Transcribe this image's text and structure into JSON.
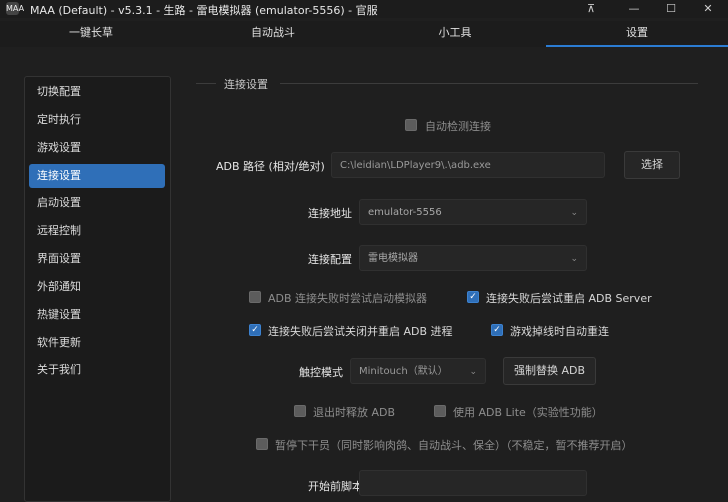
{
  "titlebar": {
    "app_icon": "MAA",
    "title": "MAA (Default) - v5.3.1 - 生路 - 雷电模拟器 (emulator-5556) - 官服",
    "controls": {
      "pin": "⊼",
      "minimize": "—",
      "maximize": "☐",
      "close": "✕"
    }
  },
  "tabs": [
    {
      "label": "一键长草"
    },
    {
      "label": "自动战斗"
    },
    {
      "label": "小工具"
    },
    {
      "label": "设置"
    }
  ],
  "sidebar": {
    "items": [
      {
        "label": "切换配置"
      },
      {
        "label": "定时执行"
      },
      {
        "label": "游戏设置"
      },
      {
        "label": "连接设置"
      },
      {
        "label": "启动设置"
      },
      {
        "label": "远程控制"
      },
      {
        "label": "界面设置"
      },
      {
        "label": "外部通知"
      },
      {
        "label": "热键设置"
      },
      {
        "label": "软件更新"
      },
      {
        "label": "关于我们"
      }
    ],
    "active_index": 3
  },
  "section": {
    "title": "连接设置"
  },
  "auto_detect": {
    "label": "自动检测连接",
    "checked": false
  },
  "adb_path": {
    "label": "ADB 路径 (相对/绝对)",
    "value": "C:\\leidian\\LDPlayer9\\.\\adb.exe",
    "select_button": "选择"
  },
  "address": {
    "label": "连接地址",
    "value": "emulator-5556"
  },
  "config": {
    "label": "连接配置",
    "value": "雷电模拟器"
  },
  "options": {
    "retry_launch_emulator": {
      "label": "ADB 连接失败时尝试启动模拟器",
      "checked": false
    },
    "retry_restart_adb": {
      "label": "连接失败后尝试重启 ADB Server",
      "checked": true
    },
    "retry_kill_restart_adb": {
      "label": "连接失败后尝试关闭并重启 ADB 进程",
      "checked": true
    },
    "auto_reconnect": {
      "label": "游戏掉线时自动重连",
      "checked": true
    }
  },
  "touch": {
    "label": "触控模式",
    "value": "Minitouch（默认）",
    "force_replace_button": "强制替换 ADB"
  },
  "release_on_exit": {
    "label": "退出时释放 ADB",
    "checked": false
  },
  "adb_lite": {
    "label": "使用 ADB Lite（实验性功能）",
    "checked": false
  },
  "pause_operator": {
    "label": "暂停下干员（同时影响肉鸽、自动战斗、保全）（不稳定，暂不推荐开启）",
    "checked": false
  },
  "pre_script": {
    "label": "开始前脚本"
  },
  "colors": {
    "accent": "#2f6fb8",
    "background": "#1f1f1f"
  },
  "icons": {
    "check": "✓",
    "chevron": "⌄"
  }
}
